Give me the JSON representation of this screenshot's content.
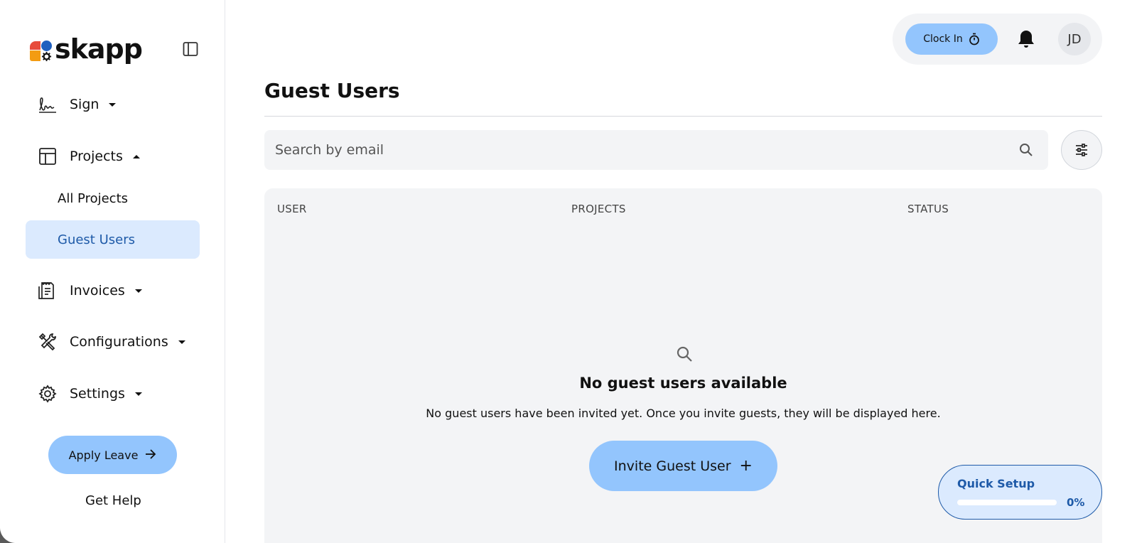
{
  "app": {
    "name": "skapp"
  },
  "sidebar": {
    "items": [
      {
        "label": "Sign",
        "icon": "signature-icon",
        "expanded": false
      },
      {
        "label": "Projects",
        "icon": "projects-grid-icon",
        "expanded": true,
        "subitems": [
          {
            "label": "All Projects",
            "active": false
          },
          {
            "label": "Guest Users",
            "active": true
          }
        ]
      },
      {
        "label": "Invoices",
        "icon": "invoice-icon",
        "expanded": false
      },
      {
        "label": "Configurations",
        "icon": "tools-icon",
        "expanded": false
      },
      {
        "label": "Settings",
        "icon": "gear-icon",
        "expanded": false
      }
    ],
    "apply_leave": "Apply Leave",
    "get_help": "Get Help"
  },
  "topbar": {
    "clock_in": "Clock In",
    "avatar_initials": "JD"
  },
  "main": {
    "title": "Guest Users",
    "search_placeholder": "Search by email",
    "table": {
      "columns": [
        "USER",
        "PROJECTS",
        "STATUS"
      ]
    },
    "empty": {
      "title": "No guest users available",
      "description": "No guest users have been invited yet. Once you invite guests, they will be displayed here.",
      "invite_button": "Invite Guest User"
    }
  },
  "quick_setup": {
    "title": "Quick Setup",
    "progress_label": "0%",
    "progress": 0
  },
  "colors": {
    "accent": "#93c5fd",
    "active_bg": "#dbeafe",
    "active_text": "#1e5aa8"
  }
}
